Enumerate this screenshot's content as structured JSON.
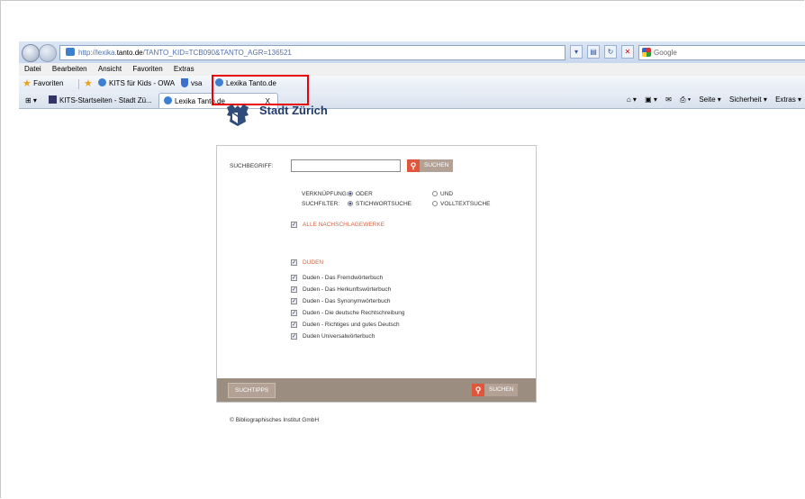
{
  "browser": {
    "address": {
      "prefix": "http://lexika.",
      "domain": "tanto.de",
      "suffix": "/TANTO_KID=TCB090&TANTO_AGR=136521"
    },
    "search_engine": "Google",
    "menu": [
      "Datei",
      "Bearbeiten",
      "Ansicht",
      "Favoriten",
      "Extras"
    ],
    "favorites": {
      "label": "Favoriten",
      "items": [
        "KITS für Kids - OWA",
        "vsa",
        "Lexika Tanto.de"
      ]
    },
    "tabs": [
      {
        "label": "KITS-Startseiten - Stadt Zü..."
      },
      {
        "label": "Lexika Tanto.de"
      }
    ],
    "tab_close": "X",
    "command_bar": [
      "Seite ▾",
      "Sicherheit ▾",
      "Extras ▾"
    ],
    "highlight_color": "#e8000b"
  },
  "page": {
    "logo_text": "Stadt Zürich",
    "search": {
      "label": "SUCHBEGRIFF:",
      "value": "",
      "button": "SUCHEN",
      "link_label": "VERKNÜPFUNG:",
      "link_options": [
        {
          "label": "ODER",
          "checked": true
        },
        {
          "label": "UND",
          "checked": false
        }
      ],
      "filter_label": "SUCHFILTER:",
      "filter_options": [
        {
          "label": "STICHWORTSUCHE",
          "checked": true
        },
        {
          "label": "VOLLTEXTSUCHE",
          "checked": false
        }
      ]
    },
    "all_works": "ALLE NACHSCHLAGEWERKE",
    "duden_header": "DUDEN",
    "works": [
      "Duden - Das Fremdwörterbuch",
      "Duden - Das Herkunftswörterbuch",
      "Duden - Das Synonymwörterbuch",
      "Duden - Die deutsche Rechtschreibung",
      "Duden - Richtiges und gutes Deutsch",
      "Duden Universalwörterbuch"
    ],
    "tips_button": "SUCHTIPPS",
    "bottom_search_button": "SUCHEN",
    "copyright": "© Bibliographisches Institut GmbH",
    "accent_color": "#d9633f"
  }
}
